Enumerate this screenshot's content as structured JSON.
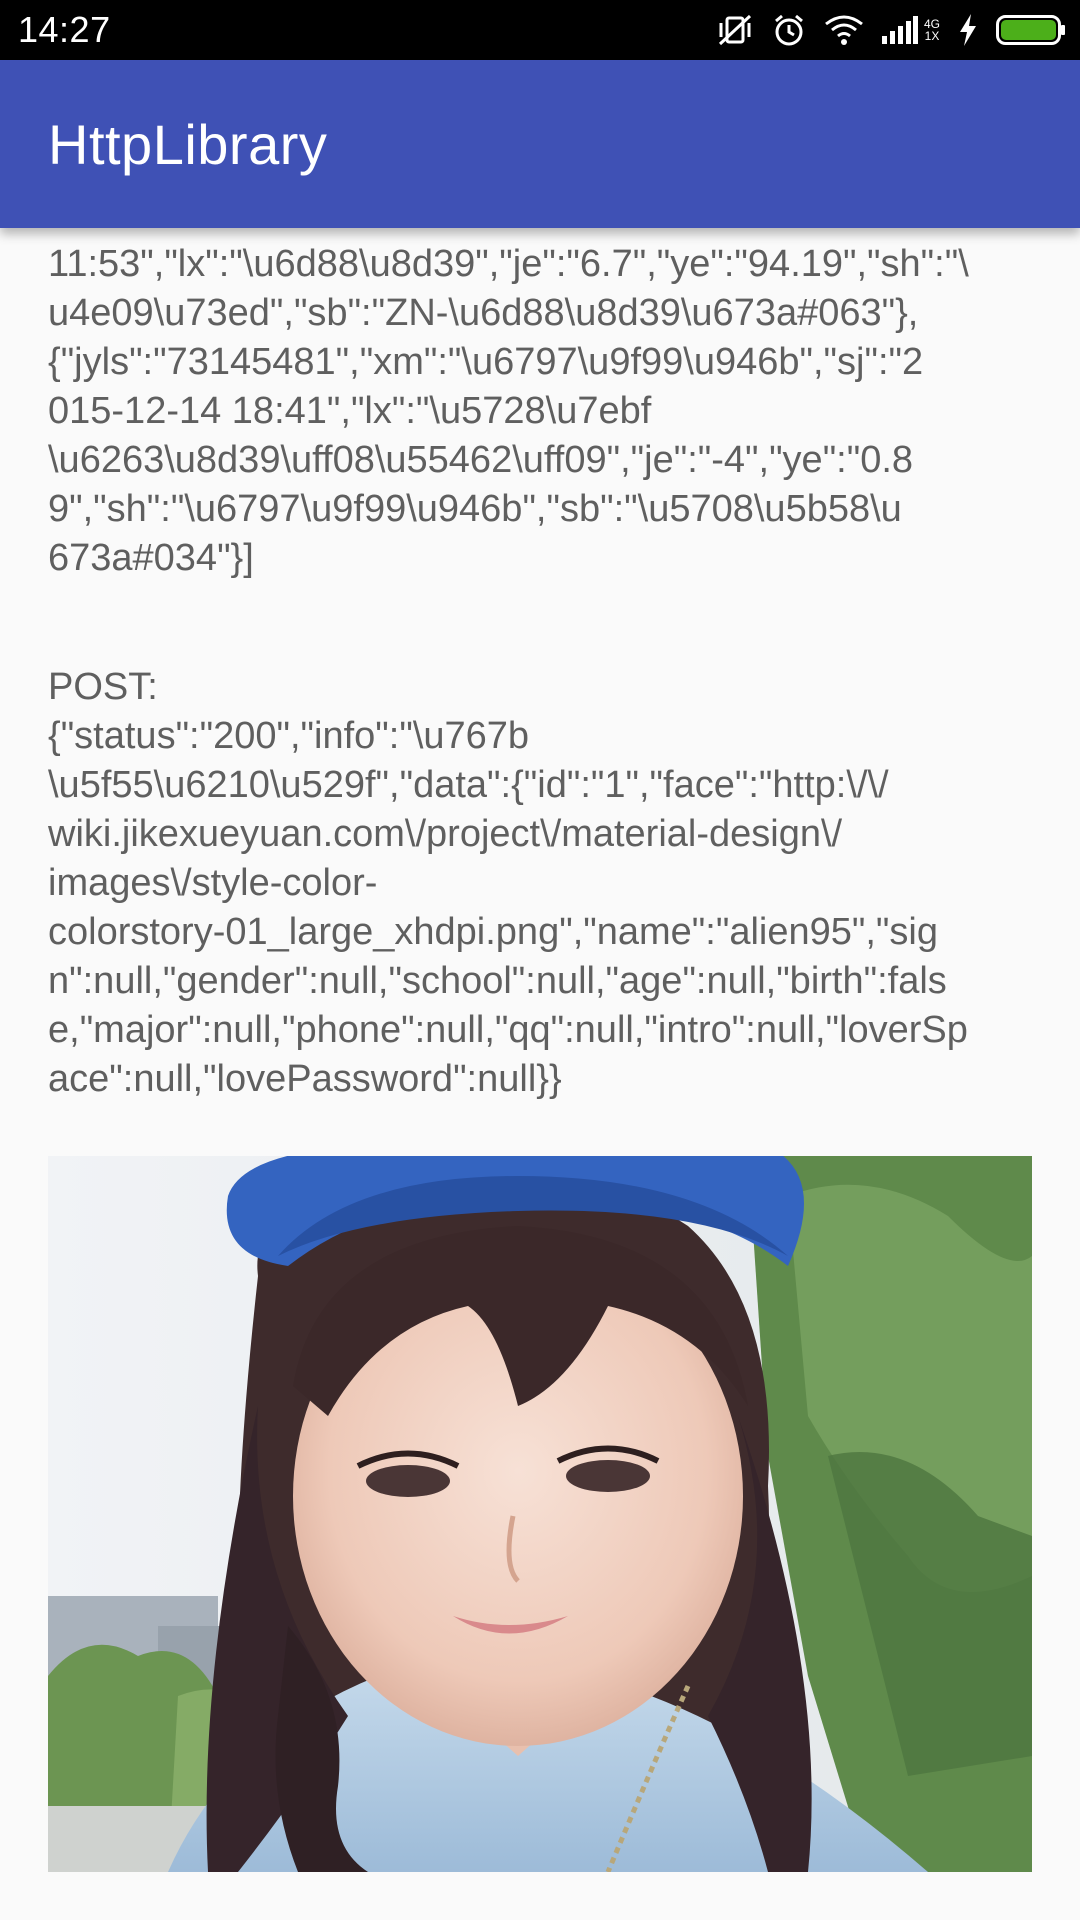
{
  "status_bar": {
    "time": "14:27",
    "icons": [
      "vibrate-icon",
      "alarm-icon",
      "wifi-icon",
      "signal-icon",
      "charging-icon",
      "battery-icon"
    ],
    "network_label_top": "4G",
    "network_label_bottom": "1X",
    "battery_color": "#4caf1a"
  },
  "app_bar": {
    "title": "HttpLibrary",
    "color": "#3f51b5"
  },
  "content": {
    "get_response": "11:53\",\"lx\":\"\\u6d88\\u8d39\",\"je\":\"6.7\",\"ye\":\"94.19\",\"sh\":\"\\\nu4e09\\u73ed\",\"sb\":\"ZN-\\u6d88\\u8d39\\u673a#063\"},\n{\"jyls\":\"73145481\",\"xm\":\"\\u6797\\u9f99\\u946b\",\"sj\":\"2\n015-12-14 18:41\",\"lx\":\"\\u5728\\u7ebf\n\\u6263\\u8d39\\uff08\\u55462\\uff09\",\"je\":\"-4\",\"ye\":\"0.8\n9\",\"sh\":\"\\u6797\\u9f99\\u946b\",\"sb\":\"\\u5708\\u5b58\\u\n673a#034\"}]",
    "post_response": "POST:\n{\"status\":\"200\",\"info\":\"\\u767b\n\\u5f55\\u6210\\u529f\",\"data\":{\"id\":\"1\",\"face\":\"http:\\/\\/\nwiki.jikexueyuan.com\\/project\\/material-design\\/\nimages\\/style-color-\ncolorstory-01_large_xhdpi.png\",\"name\":\"alien95\",\"sig\nn\":null,\"gender\":null,\"school\":null,\"age\":null,\"birth\":fals\ne,\"major\":null,\"phone\":null,\"qq\":null,\"intro\":null,\"loverSp\nace\":null,\"lovePassword\":null}}",
    "text_color": "#5f5f5f",
    "image": "profile-photo"
  }
}
